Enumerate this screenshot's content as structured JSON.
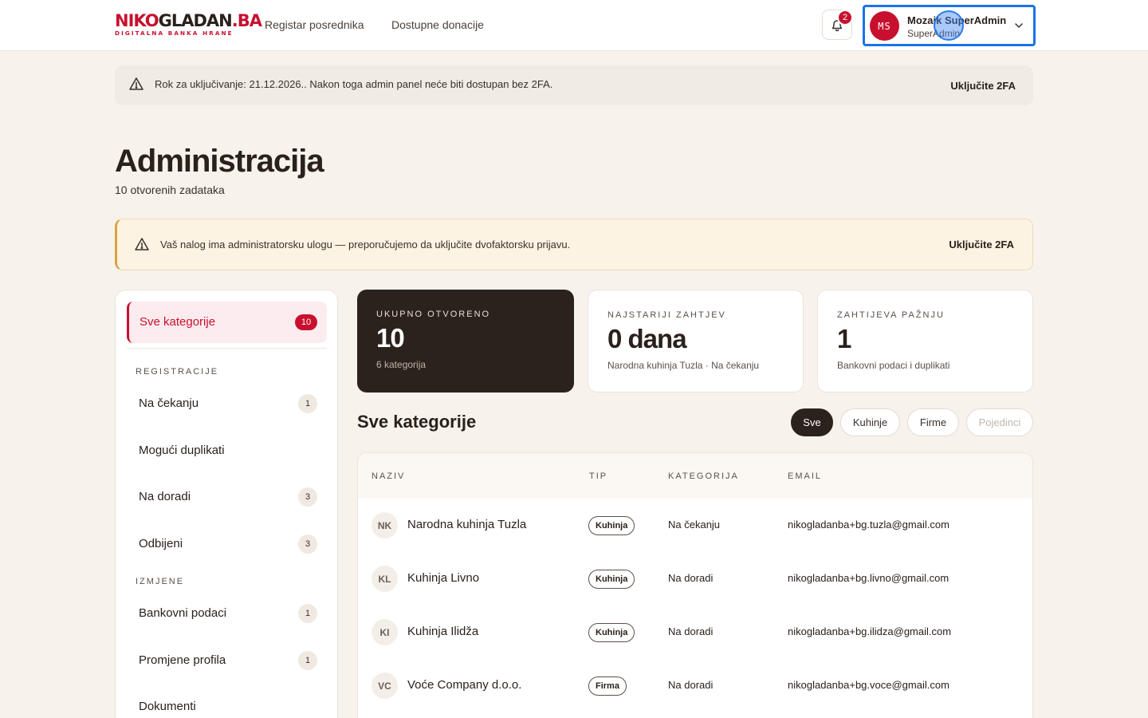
{
  "header": {
    "logo_main_red": "NIKO",
    "logo_main_dark": "GLADAN",
    "logo_main_suffix": ".BA",
    "logo_sub": "DIGITALNA BANKA HRANE",
    "nav": [
      "Registar posrednika",
      "Dostupne donacije"
    ],
    "notifications_count": "2",
    "user": {
      "initials": "MS",
      "name": "Mozaik SuperAdmin",
      "role": "SuperAdmin"
    }
  },
  "banner_top": {
    "text": "Rok za uključivanje: 21.12.2026.. Nakon toga admin panel neće biti dostupan bez 2FA.",
    "action": "Uključite 2FA"
  },
  "page": {
    "title": "Administracija",
    "subtitle": "10 otvorenih zadataka"
  },
  "banner_warning": {
    "text": "Vaš nalog ima administratorsku ulogu — preporučujemo da uključite dvofaktorsku prijavu.",
    "action": "Uključite 2FA"
  },
  "sidebar": {
    "all": {
      "label": "Sve kategorije",
      "count": "10"
    },
    "sections": [
      {
        "title": "REGISTRACIJE",
        "items": [
          {
            "label": "Na čekanju",
            "count": "1"
          },
          {
            "label": "Mogući duplikati",
            "count": ""
          },
          {
            "label": "Na doradi",
            "count": "3"
          },
          {
            "label": "Odbijeni",
            "count": "3"
          }
        ]
      },
      {
        "title": "IZMJENE",
        "items": [
          {
            "label": "Bankovni podaci",
            "count": "1"
          },
          {
            "label": "Promjene profila",
            "count": "1"
          },
          {
            "label": "Dokumenti",
            "count": ""
          }
        ]
      }
    ]
  },
  "stats": [
    {
      "label": "UKUPNO OTVORENO",
      "value": "10",
      "sub": "6 kategorija"
    },
    {
      "label": "NAJSTARIJI ZAHTJEV",
      "value": "0 dana",
      "sub": "Narodna kuhinja Tuzla · Na čekanju"
    },
    {
      "label": "ZAHTIJEVA PAŽNJU",
      "value": "1",
      "sub": "Bankovni podaci i duplikati"
    }
  ],
  "list": {
    "title": "Sve kategorije",
    "filters": [
      "Sve",
      "Kuhinje",
      "Firme",
      "Pojedinci"
    ],
    "active_filter": "Sve",
    "columns": [
      "NAZIV",
      "TIP",
      "KATEGORIJA",
      "EMAIL"
    ],
    "rows": [
      {
        "initials": "NK",
        "name": "Narodna kuhinja Tuzla",
        "type": "Kuhinja",
        "category": "Na čekanju",
        "email": "nikogladanba+bg.tuzla@gmail.com"
      },
      {
        "initials": "KL",
        "name": "Kuhinja Livno",
        "type": "Kuhinja",
        "category": "Na doradi",
        "email": "nikogladanba+bg.livno@gmail.com"
      },
      {
        "initials": "KI",
        "name": "Kuhinja Ilidža",
        "type": "Kuhinja",
        "category": "Na doradi",
        "email": "nikogladanba+bg.ilidza@gmail.com"
      },
      {
        "initials": "VC",
        "name": "Voće Company d.o.o.",
        "type": "Firma",
        "category": "Na doradi",
        "email": "nikogladanba+bg.voce@gmail.com"
      }
    ]
  },
  "colors": {
    "brand": "#c8102e",
    "dark": "#2c221d",
    "background": "#f7f2ec",
    "focus": "#1a73e8",
    "warning": "#d9a441"
  },
  "icons": {
    "bell": "bell-icon",
    "warning": "warning-icon",
    "chevron": "chevron-down-icon"
  }
}
